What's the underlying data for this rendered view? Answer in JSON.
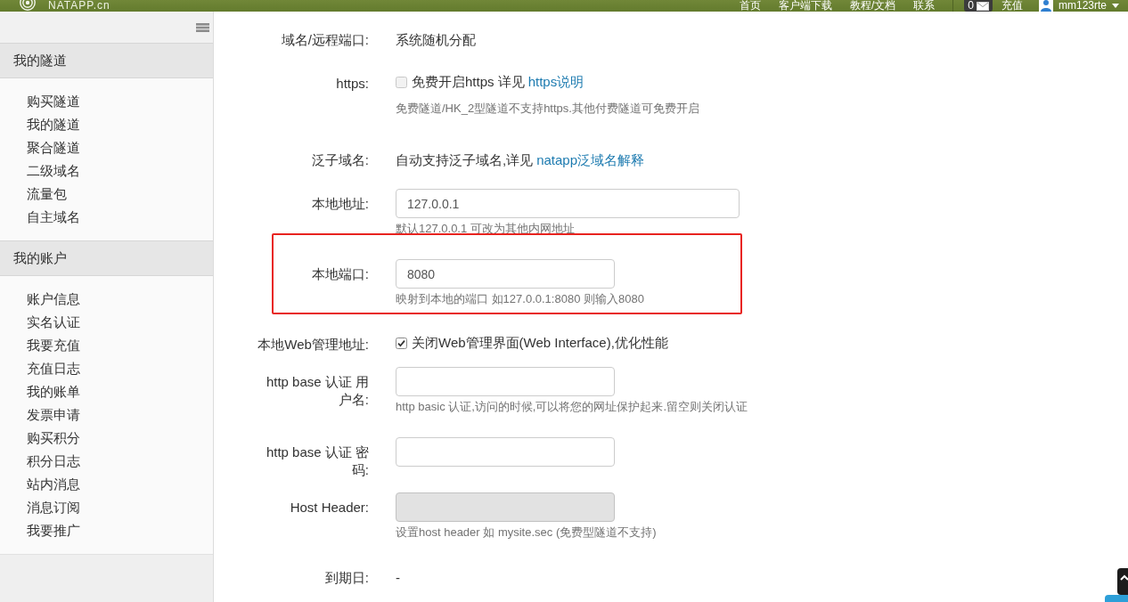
{
  "top_bar": {
    "logo": "NATAPP.cn",
    "nav": [
      "首页",
      "客户端下载",
      "教程/文档",
      "联系"
    ],
    "message_count": "0",
    "recharge": "充值",
    "user": "mm123rte"
  },
  "sidebar": {
    "sections": [
      {
        "title": "我的隧道",
        "items": [
          "购买隧道",
          "我的隧道",
          "聚合隧道",
          "二级域名",
          "流量包",
          "自主域名"
        ]
      },
      {
        "title": "我的账户",
        "items": [
          "账户信息",
          "实名认证",
          "我要充值",
          "充值日志",
          "我的账单",
          "发票申请",
          "购买积分",
          "积分日志",
          "站内消息",
          "消息订阅",
          "我要推广"
        ]
      }
    ]
  },
  "form": {
    "rows": [
      {
        "kind": "text",
        "label": "域名/远程端口:",
        "value": "系统随机分配",
        "highlighted": false
      },
      {
        "kind": "checkbox",
        "label": "https:",
        "checked": false,
        "text": "免费开启https 详见",
        "link": "https说明",
        "help": "免费隧道/HK_2型隧道不支持https.其他付费隧道可免费开启",
        "highlighted": false
      },
      {
        "kind": "text",
        "label": "泛子域名:",
        "value": "自动支持泛子域名,详见",
        "link": "natapp泛域名解释",
        "highlighted": false
      },
      {
        "kind": "input",
        "label": "本地地址:",
        "value": "127.0.0.1",
        "disabled": false,
        "help": "默认127.0.0.1 可改为其他内网地址",
        "highlighted": false
      },
      {
        "kind": "input",
        "label": "本地端口:",
        "value": "8080",
        "disabled": false,
        "help": "映射到本地的端口 如127.0.0.1:8080 则输入8080",
        "highlighted": true
      },
      {
        "kind": "checkbox",
        "label": "本地Web管理地址:",
        "checked": true,
        "text": "关闭Web管理界面(Web Interface),优化性能",
        "highlighted": false
      },
      {
        "kind": "input",
        "label": "http base 认证 用户名:",
        "disabled": false,
        "help": "http basic 认证,访问的时候,可以将您的网址保护起来.留空则关闭认证",
        "highlighted": false
      },
      {
        "kind": "input",
        "label": "http base 认证 密码:",
        "disabled": false,
        "highlighted": false
      },
      {
        "kind": "input",
        "label": "Host Header:",
        "disabled": true,
        "help": "设置host header 如 mysite.sec (免费型隧道不支持)",
        "highlighted": false
      },
      {
        "kind": "text",
        "label": "到期日:",
        "value": "-",
        "highlighted": false
      }
    ]
  }
}
